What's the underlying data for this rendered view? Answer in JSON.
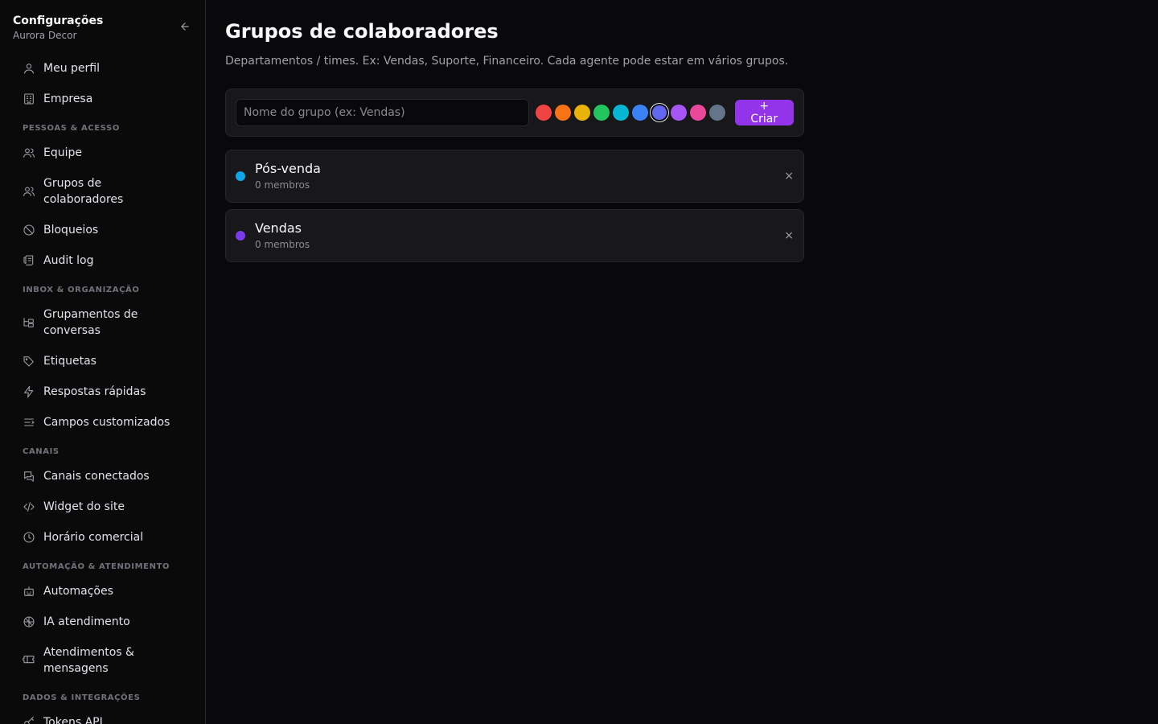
{
  "sidebar": {
    "title": "Configurações",
    "subtitle": "Aurora Decor",
    "sections": [
      {
        "label": "",
        "items": [
          {
            "label": "Meu perfil",
            "icon": "user-icon"
          },
          {
            "label": "Empresa",
            "icon": "building-icon"
          }
        ]
      },
      {
        "label": "PESSOAS & ACESSO",
        "items": [
          {
            "label": "Equipe",
            "icon": "users-icon"
          },
          {
            "label": "Grupos de colaboradores",
            "icon": "users-group-icon",
            "active": true
          },
          {
            "label": "Bloqueios",
            "icon": "ban-icon"
          },
          {
            "label": "Audit log",
            "icon": "scroll-icon"
          }
        ]
      },
      {
        "label": "INBOX & ORGANIZAÇÃO",
        "items": [
          {
            "label": "Grupamentos de conversas",
            "icon": "folder-tree-icon"
          },
          {
            "label": "Etiquetas",
            "icon": "tag-icon"
          },
          {
            "label": "Respostas rápidas",
            "icon": "zap-icon"
          },
          {
            "label": "Campos customizados",
            "icon": "list-fields-icon"
          }
        ]
      },
      {
        "label": "CANAIS",
        "items": [
          {
            "label": "Canais conectados",
            "icon": "messages-icon"
          },
          {
            "label": "Widget do site",
            "icon": "code-icon"
          },
          {
            "label": "Horário comercial",
            "icon": "clock-icon"
          }
        ]
      },
      {
        "label": "AUTOMAÇÃO & ATENDIMENTO",
        "items": [
          {
            "label": "Automações",
            "icon": "bot-icon"
          },
          {
            "label": "IA atendimento",
            "icon": "brain-icon"
          },
          {
            "label": "Atendimentos & mensagens",
            "icon": "ticket-icon"
          }
        ]
      },
      {
        "label": "DADOS & INTEGRAÇÕES",
        "items": [
          {
            "label": "Tokens API",
            "icon": "key-icon"
          }
        ]
      }
    ]
  },
  "main": {
    "title": "Grupos de colaboradores",
    "description": "Departamentos / times. Ex: Vendas, Suporte, Financeiro. Cada agente pode estar em vários grupos.",
    "create": {
      "placeholder": "Nome do grupo (ex: Vendas)",
      "value": "",
      "button_label": "+ Criar",
      "colors": [
        "#ef4444",
        "#f97316",
        "#eab308",
        "#22c55e",
        "#06b6d4",
        "#3b82f6",
        "#6366f1",
        "#a855f7",
        "#ec4899",
        "#64748b"
      ],
      "selected_color_index": 6
    },
    "groups": [
      {
        "name": "Pós-venda",
        "members": "0 membros",
        "color": "#0ea5e9"
      },
      {
        "name": "Vendas",
        "members": "0 membros",
        "color": "#7c3aed"
      }
    ],
    "remove_label": "×"
  }
}
